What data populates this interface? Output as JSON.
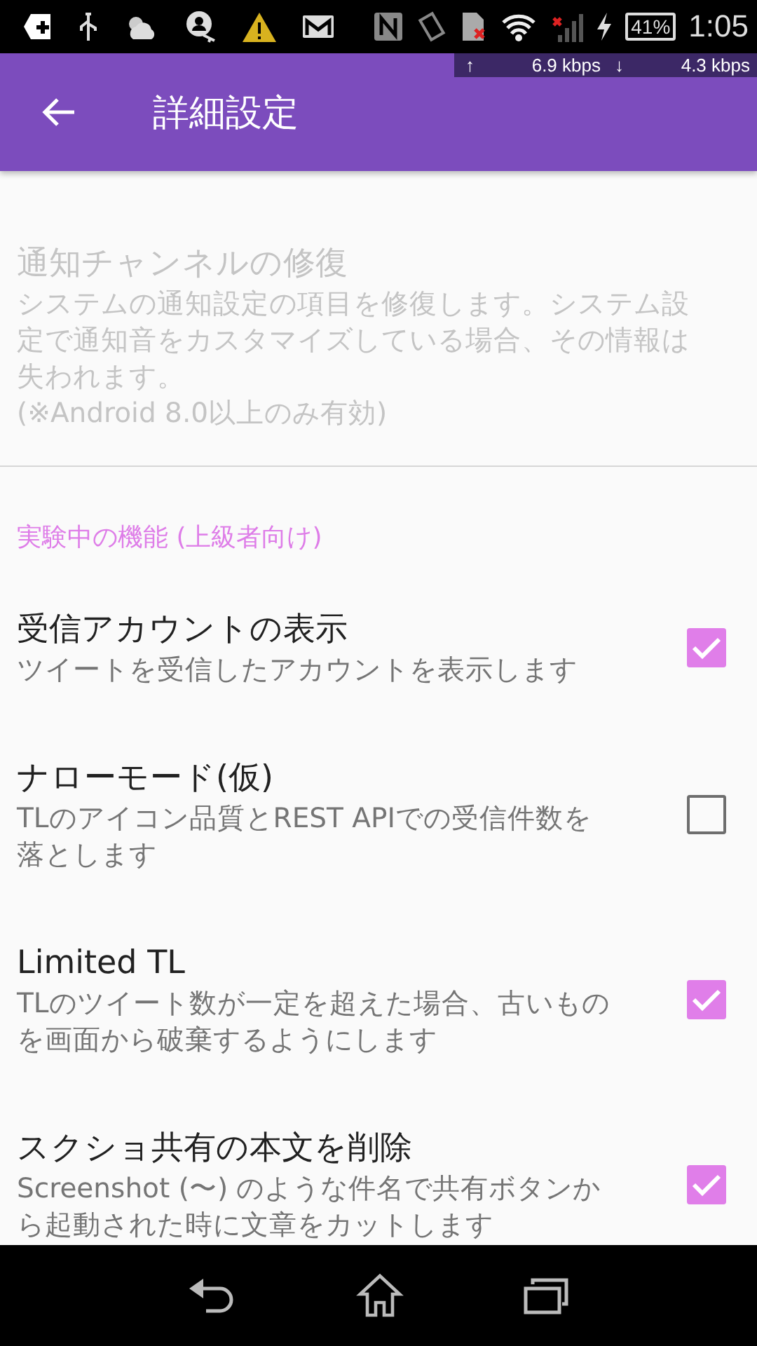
{
  "status_bar": {
    "battery": "41%",
    "time": "1:05"
  },
  "network_meter": {
    "up_arrow": "↑",
    "up_speed": "6.9 kbps",
    "down_arrow": "↓",
    "down_speed": "4.3 kbps"
  },
  "app_bar": {
    "title": "詳細設定"
  },
  "sections": [
    {
      "items": [
        {
          "kind": "plain",
          "title": "通知チャンネルの修復",
          "summary": "システムの通知設定の項目を修復します。システム設定で通知音をカスタマイズしている場合、その情報は失われます。",
          "note": "(※Android 8.0以上のみ有効)",
          "disabled": true
        }
      ]
    },
    {
      "header": "実験中の機能 (上級者向け)",
      "items": [
        {
          "kind": "checkbox",
          "title": "受信アカウントの表示",
          "summary": "ツイートを受信したアカウントを表示します",
          "disabled": false,
          "checked": true
        },
        {
          "kind": "checkbox",
          "title": "ナローモード(仮)",
          "summary": "TLのアイコン品質とREST APIでの受信件数を落とします",
          "disabled": false,
          "checked": false
        },
        {
          "kind": "checkbox",
          "title": "Limited TL",
          "summary": "TLのツイート数が一定を超えた場合、古いものを画面から破棄するようにします",
          "disabled": false,
          "checked": true
        },
        {
          "kind": "checkbox",
          "title": "スクショ共有の本文を削除",
          "summary": "Screenshot (〜) のような件名で共有ボタンから起動された時に文章をカットします",
          "disabled": false,
          "checked": true
        }
      ]
    }
  ]
}
